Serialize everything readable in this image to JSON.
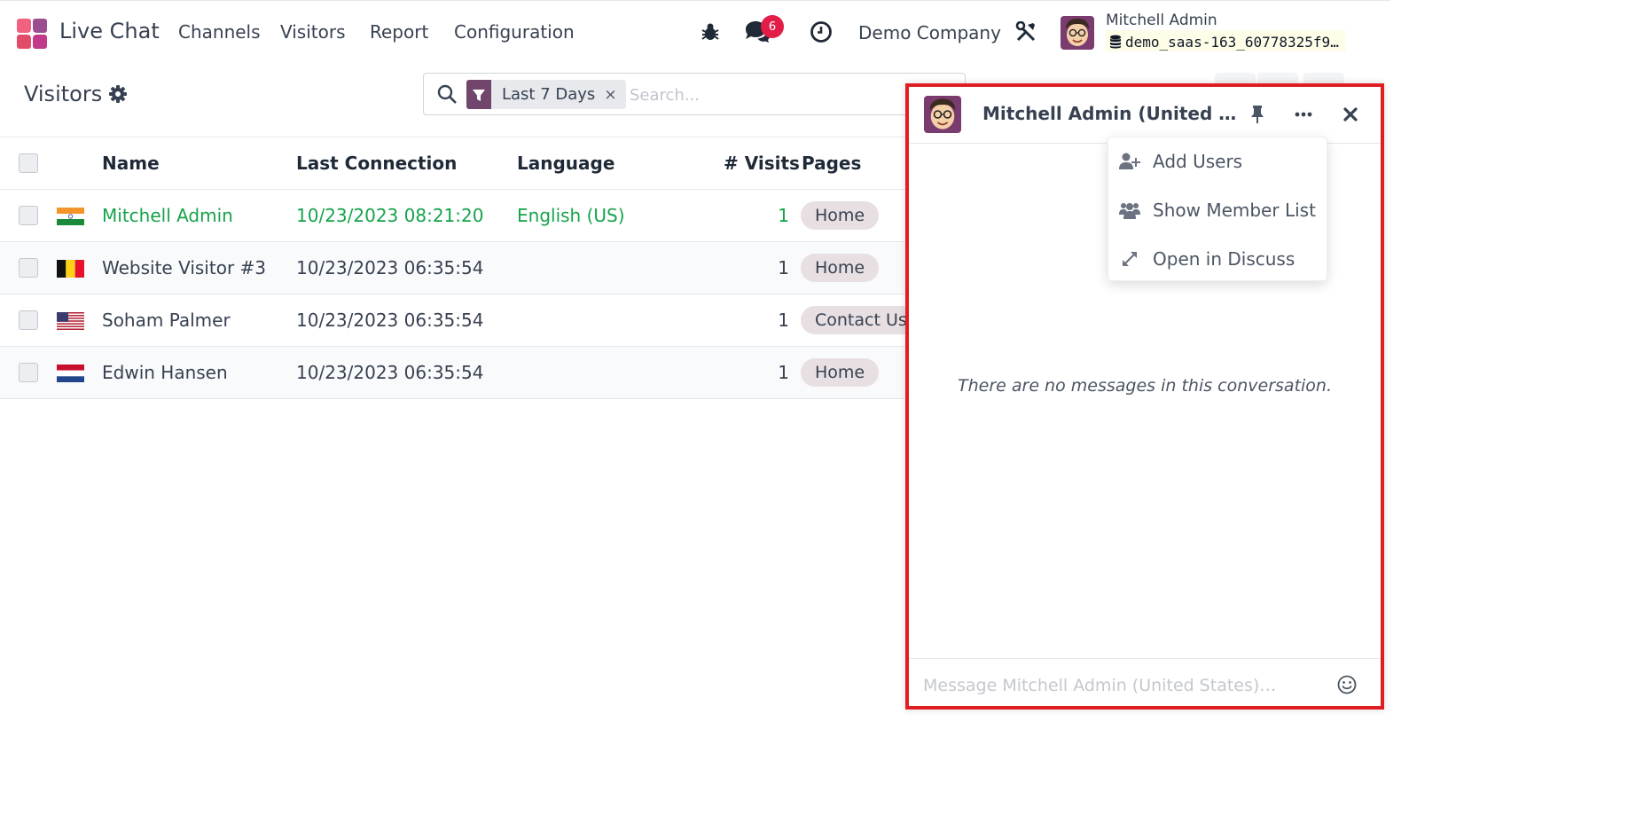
{
  "navbar": {
    "app_name": "Live Chat",
    "menu": [
      "Channels",
      "Visitors",
      "Report",
      "Configuration"
    ],
    "messages_badge": "6",
    "company": "Demo Company",
    "user_name": "Mitchell Admin",
    "database": "demo_saas-163_60778325f9…"
  },
  "control_panel": {
    "title": "Visitors",
    "facet_label": "Last 7 Days",
    "facet_remove": "×",
    "search_placeholder": "Search..."
  },
  "table": {
    "columns": [
      "Name",
      "Last Connection",
      "Language",
      "# Visits",
      "Pages"
    ],
    "rows": [
      {
        "flag": "india-flag",
        "name": "Mitchell Admin",
        "last_connection": "10/23/2023 08:21:20",
        "language": "English (US)",
        "visits": "1",
        "page": "Home",
        "online": true
      },
      {
        "flag": "belgium-flag",
        "name": "Website Visitor #3",
        "last_connection": "10/23/2023 06:35:54",
        "language": "",
        "visits": "1",
        "page": "Home",
        "online": false
      },
      {
        "flag": "usa-flag",
        "name": "Soham Palmer",
        "last_connection": "10/23/2023 06:35:54",
        "language": "",
        "visits": "1",
        "page": "Contact Us",
        "online": false
      },
      {
        "flag": "netherlands-flag",
        "name": "Edwin Hansen",
        "last_connection": "10/23/2023 06:35:54",
        "language": "",
        "visits": "1",
        "page": "Home",
        "online": false
      }
    ]
  },
  "chat": {
    "title": "Mitchell Admin (United States)",
    "menu": [
      "Add Users",
      "Show Member List",
      "Open in Discuss"
    ],
    "empty_message": "There are no messages in this conversation.",
    "composer_placeholder": "Message Mitchell Admin (United States)…"
  },
  "colors": {
    "accent": "#71456c",
    "online": "#16a34a",
    "badge": "#e11d48",
    "highlight_border": "#e11d24"
  }
}
